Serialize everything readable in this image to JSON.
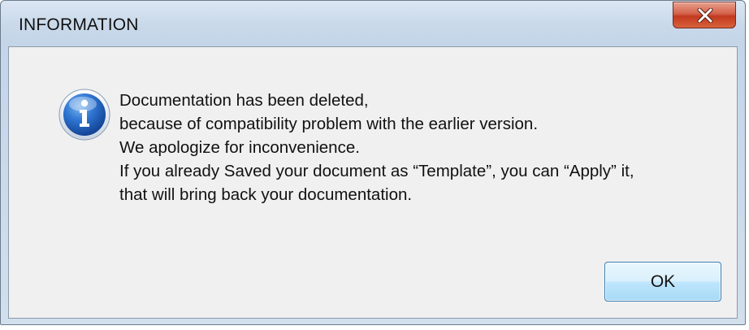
{
  "window": {
    "title": "INFORMATION"
  },
  "titlebar": {
    "close_icon": "close-x-icon",
    "close_color": "#c2391f"
  },
  "dialog": {
    "icon": "info-icon",
    "icon_color": "#1f5fb8",
    "message_lines": [
      "Documentation has been deleted,",
      "because of compatibility problem with the earlier version.",
      "We apologize for inconvenience.",
      "If you already Saved your document as “Template”, you can “Apply” it,",
      "that will bring back your documentation."
    ],
    "ok_label": "OK"
  }
}
